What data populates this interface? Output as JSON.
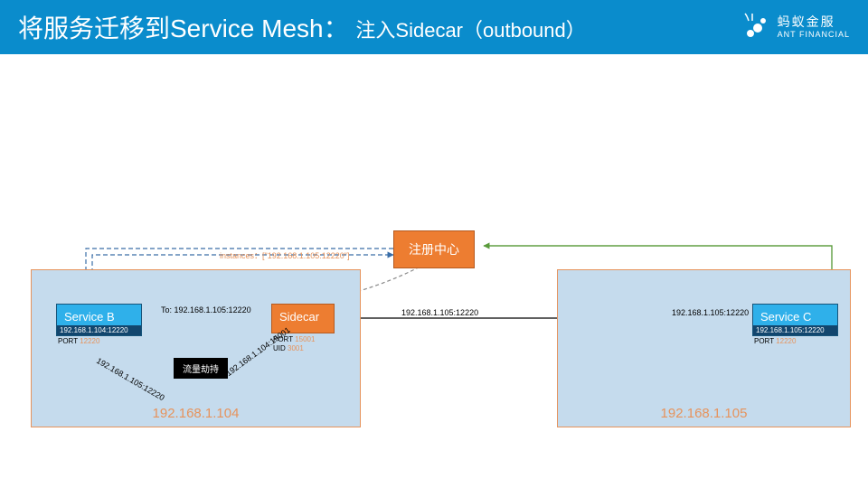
{
  "header": {
    "title_main": "将服务迁移到Service Mesh：",
    "title_sub": "注入Sidecar（outbound）",
    "brand_cn": "蚂蚁金服",
    "brand_en": "ANT FINANCIAL"
  },
  "registry": {
    "label": "注册中心"
  },
  "hosts": {
    "left_ip": "192.168.1.104",
    "right_ip": "192.168.1.105"
  },
  "serviceB": {
    "title": "Service B",
    "addr": "192.168.1.104:12220",
    "port_label": "PORT",
    "port_value": "12220"
  },
  "sidecar": {
    "title": "Sidecar",
    "port_label": "PORT",
    "port_value": "15001",
    "uid_label": "UID",
    "uid_value": "3001"
  },
  "serviceC": {
    "title": "Service C",
    "addr": "192.168.1.105:12220",
    "port_label": "PORT",
    "port_value": "12220"
  },
  "traffic_intercept": "流量劫持",
  "labels": {
    "instances": "instances：[\"192.168.1.105:12220\"]",
    "to": "To: 192.168.1.105:12220",
    "mid": "192.168.1.105:12220",
    "right": "192.168.1.105:12220",
    "diag_left": "192.168.1.105:12220",
    "diag_right": "192.168.1.104:15001"
  }
}
